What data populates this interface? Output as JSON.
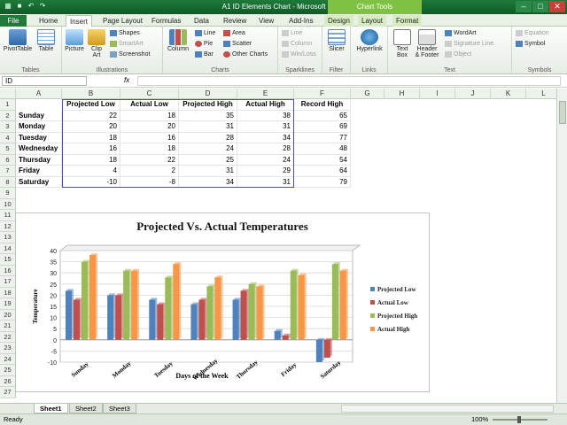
{
  "window": {
    "title": "A1 ID Elements Chart - Microsoft Excel",
    "context_label": "Chart Tools"
  },
  "tabs": [
    "File",
    "Home",
    "Insert",
    "Page Layout",
    "Formulas",
    "Data",
    "Review",
    "View",
    "Add-Ins",
    "Design",
    "Layout",
    "Format"
  ],
  "ribbon": {
    "tables": {
      "label": "Tables",
      "pivottable": "PivotTable",
      "table": "Table"
    },
    "illustrations": {
      "label": "Illustrations",
      "picture": "Picture",
      "clipart": "Clip Art",
      "shapes": "Shapes",
      "smartart": "SmartArt",
      "screenshot": "Screenshot"
    },
    "charts": {
      "label": "Charts",
      "column": "Column",
      "line": "Line",
      "pie": "Pie",
      "bar": "Bar",
      "area": "Area",
      "scatter": "Scatter",
      "other": "Other Charts"
    },
    "sparklines": {
      "label": "Sparklines",
      "line": "Line",
      "column": "Column",
      "winloss": "Win/Loss"
    },
    "filter": {
      "label": "Filter",
      "slicer": "Slicer"
    },
    "links": {
      "label": "Links",
      "hyperlink": "Hyperlink"
    },
    "text": {
      "label": "Text",
      "textbox": "Text Box",
      "header": "Header & Footer",
      "wordart": "WordArt",
      "signature": "Signature Line",
      "object": "Object"
    },
    "symbols": {
      "label": "Symbols",
      "equation": "Equation",
      "symbol": "Symbol"
    }
  },
  "formula_bar": {
    "name_box": "ID",
    "fx": "fx",
    "formula": ""
  },
  "columns": [
    "A",
    "B",
    "C",
    "D",
    "E",
    "F",
    "G",
    "H",
    "I",
    "J",
    "K",
    "L"
  ],
  "rows": [
    "1",
    "2",
    "3",
    "4",
    "5",
    "6",
    "7",
    "8",
    "9",
    "10",
    "11",
    "12",
    "13",
    "14",
    "15",
    "16",
    "17",
    "18",
    "19",
    "20",
    "21",
    "22",
    "23",
    "24",
    "25",
    "26",
    "27"
  ],
  "table": {
    "headers": [
      "Projected Low",
      "Actual Low",
      "Projected High",
      "Actual High",
      "Record High"
    ],
    "data": [
      {
        "day": "Sunday",
        "values": [
          "22",
          "18",
          "35",
          "38",
          "65"
        ]
      },
      {
        "day": "Monday",
        "values": [
          "20",
          "20",
          "31",
          "31",
          "69"
        ]
      },
      {
        "day": "Tuesday",
        "values": [
          "18",
          "16",
          "28",
          "34",
          "77"
        ]
      },
      {
        "day": "Wednesday",
        "values": [
          "16",
          "18",
          "24",
          "28",
          "48"
        ]
      },
      {
        "day": "Thursday",
        "values": [
          "18",
          "22",
          "25",
          "24",
          "54"
        ]
      },
      {
        "day": "Friday",
        "values": [
          "4",
          "2",
          "31",
          "29",
          "64"
        ]
      },
      {
        "day": "Saturday",
        "values": [
          "-10",
          "-8",
          "34",
          "31",
          "79"
        ]
      }
    ]
  },
  "sheets": [
    "Sheet1",
    "Sheet2",
    "Sheet3"
  ],
  "status": {
    "ready": "Ready",
    "zoom": "100%"
  },
  "colors": {
    "projected_low": "#4f81bd",
    "actual_low": "#c0504d",
    "projected_high": "#9bbb59",
    "actual_high": "#f79646"
  },
  "chart_data": {
    "type": "bar",
    "title": "Projected Vs. Actual Temperatures",
    "xlabel": "Days of the Week",
    "ylabel": "Temperature",
    "categories": [
      "Sunday",
      "Monday",
      "Tuesday",
      "Wednesday",
      "Thursday",
      "Friday",
      "Saturday"
    ],
    "series": [
      {
        "name": "Projected Low",
        "values": [
          22,
          20,
          18,
          16,
          18,
          4,
          -10
        ]
      },
      {
        "name": "Actual Low",
        "values": [
          18,
          20,
          16,
          18,
          22,
          2,
          -8
        ]
      },
      {
        "name": "Projected High",
        "values": [
          35,
          31,
          28,
          24,
          25,
          31,
          34
        ]
      },
      {
        "name": "Actual High",
        "values": [
          38,
          31,
          34,
          28,
          24,
          29,
          31
        ]
      }
    ],
    "ylim": [
      -10,
      40
    ],
    "yticks": [
      "40",
      "35",
      "30",
      "25",
      "20",
      "15",
      "10",
      "5",
      "0",
      "-5",
      "-10"
    ],
    "grid": true,
    "legend": "right"
  }
}
